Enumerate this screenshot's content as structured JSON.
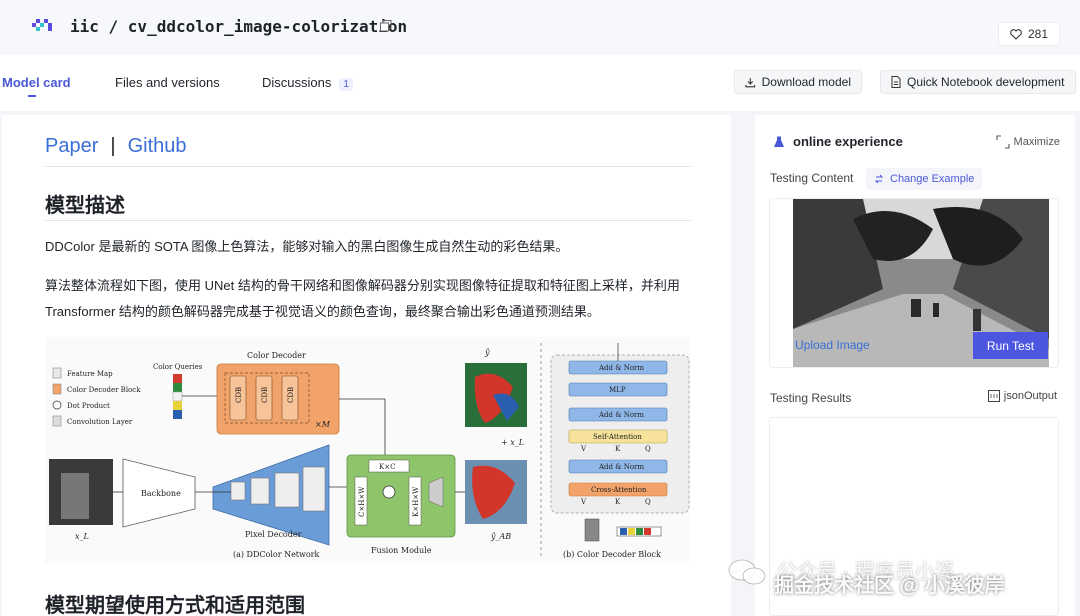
{
  "header": {
    "title": "iic / cv_ddcolor_image-colorization",
    "likes": "281"
  },
  "tabs": [
    {
      "label": "Model card",
      "active": true
    },
    {
      "label": "Files and versions",
      "active": false
    },
    {
      "label": "Discussions",
      "active": false,
      "badge": "1"
    }
  ],
  "actions": {
    "download": "Download model",
    "notebook": "Quick Notebook development"
  },
  "content": {
    "link_paper": "Paper",
    "link_sep": "|",
    "link_github": "Github",
    "heading1": "模型描述",
    "para1": "DDColor 是最新的 SOTA 图像上色算法，能够对输入的黑白图像生成自然生动的彩色结果。",
    "para2": "算法整体流程如下图，使用 UNet 结构的骨干网络和图像解码器分别实现图像特征提取和特征图上采样，并利用 Transformer 结构的颜色解码器完成基于视觉语义的颜色查询，最终聚合输出彩色通道预测结果。",
    "heading2": "模型期望使用方式和适用范围"
  },
  "diagram": {
    "legend": [
      "Feature Map",
      "Color Decoder Block",
      "Dot Product",
      "Convolution Layer"
    ],
    "color_queries": "Color Queries",
    "color_decoder": "Color Decoder",
    "cdb": "CDB",
    "xm": "×M",
    "backbone": "Backbone",
    "pixel_decoder": "Pixel Decoder",
    "fusion_module": "Fusion Module",
    "kxc": "K×C",
    "chw": "C×H×W",
    "khw": "K×H×W",
    "x_l": "x_L",
    "y_hat": "ŷ",
    "plus_xl": "+ x_L",
    "y_ab": "ŷ_AB",
    "caption_a": "(a) DDColor Network",
    "caption_b": "(b) Color Decoder Block",
    "block_labels": [
      "Add & Norm",
      "MLP",
      "Add & Norm",
      "Self-Attention",
      "Add & Norm",
      "Cross-Attention"
    ],
    "vkq": [
      "V",
      "K",
      "Q"
    ]
  },
  "panel": {
    "title": "online experience",
    "maximize": "Maximize",
    "testing_content": "Testing Content",
    "change_example": "Change Example",
    "upload": "Upload Image",
    "run": "Run Test",
    "testing_results": "Testing Results",
    "json_output": "jsonOutput"
  },
  "watermark": {
    "line1": "公众号 · 程序员小溪",
    "line2": "掘金技术社区 @ 小溪彼岸"
  },
  "colors": {
    "accent": "#4a58d8",
    "link": "#3a6ed8",
    "run_button": "#4c56e0"
  }
}
